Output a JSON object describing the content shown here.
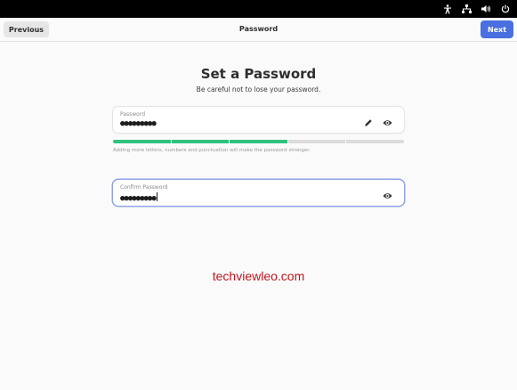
{
  "top_bar": {
    "icons": [
      "accessibility-icon",
      "network-icon",
      "volume-icon",
      "power-icon"
    ]
  },
  "header": {
    "previous_label": "Previous",
    "title": "Password",
    "next_label": "Next",
    "accent_color": "#4a6fe0"
  },
  "page": {
    "title": "Set a Password",
    "subtitle": "Be careful not to lose your password."
  },
  "password_field": {
    "label": "Password",
    "value": "●●●●●●●●●"
  },
  "strength": {
    "segments_total": 5,
    "segments_filled": 3,
    "fill_color": "#2ec27e",
    "hint": "Adding more letters, numbers and punctuation will make the password stronger."
  },
  "confirm_field": {
    "label": "Confirm Password",
    "value": "●●●●●●●●●"
  },
  "watermark": "techviewleo.com"
}
